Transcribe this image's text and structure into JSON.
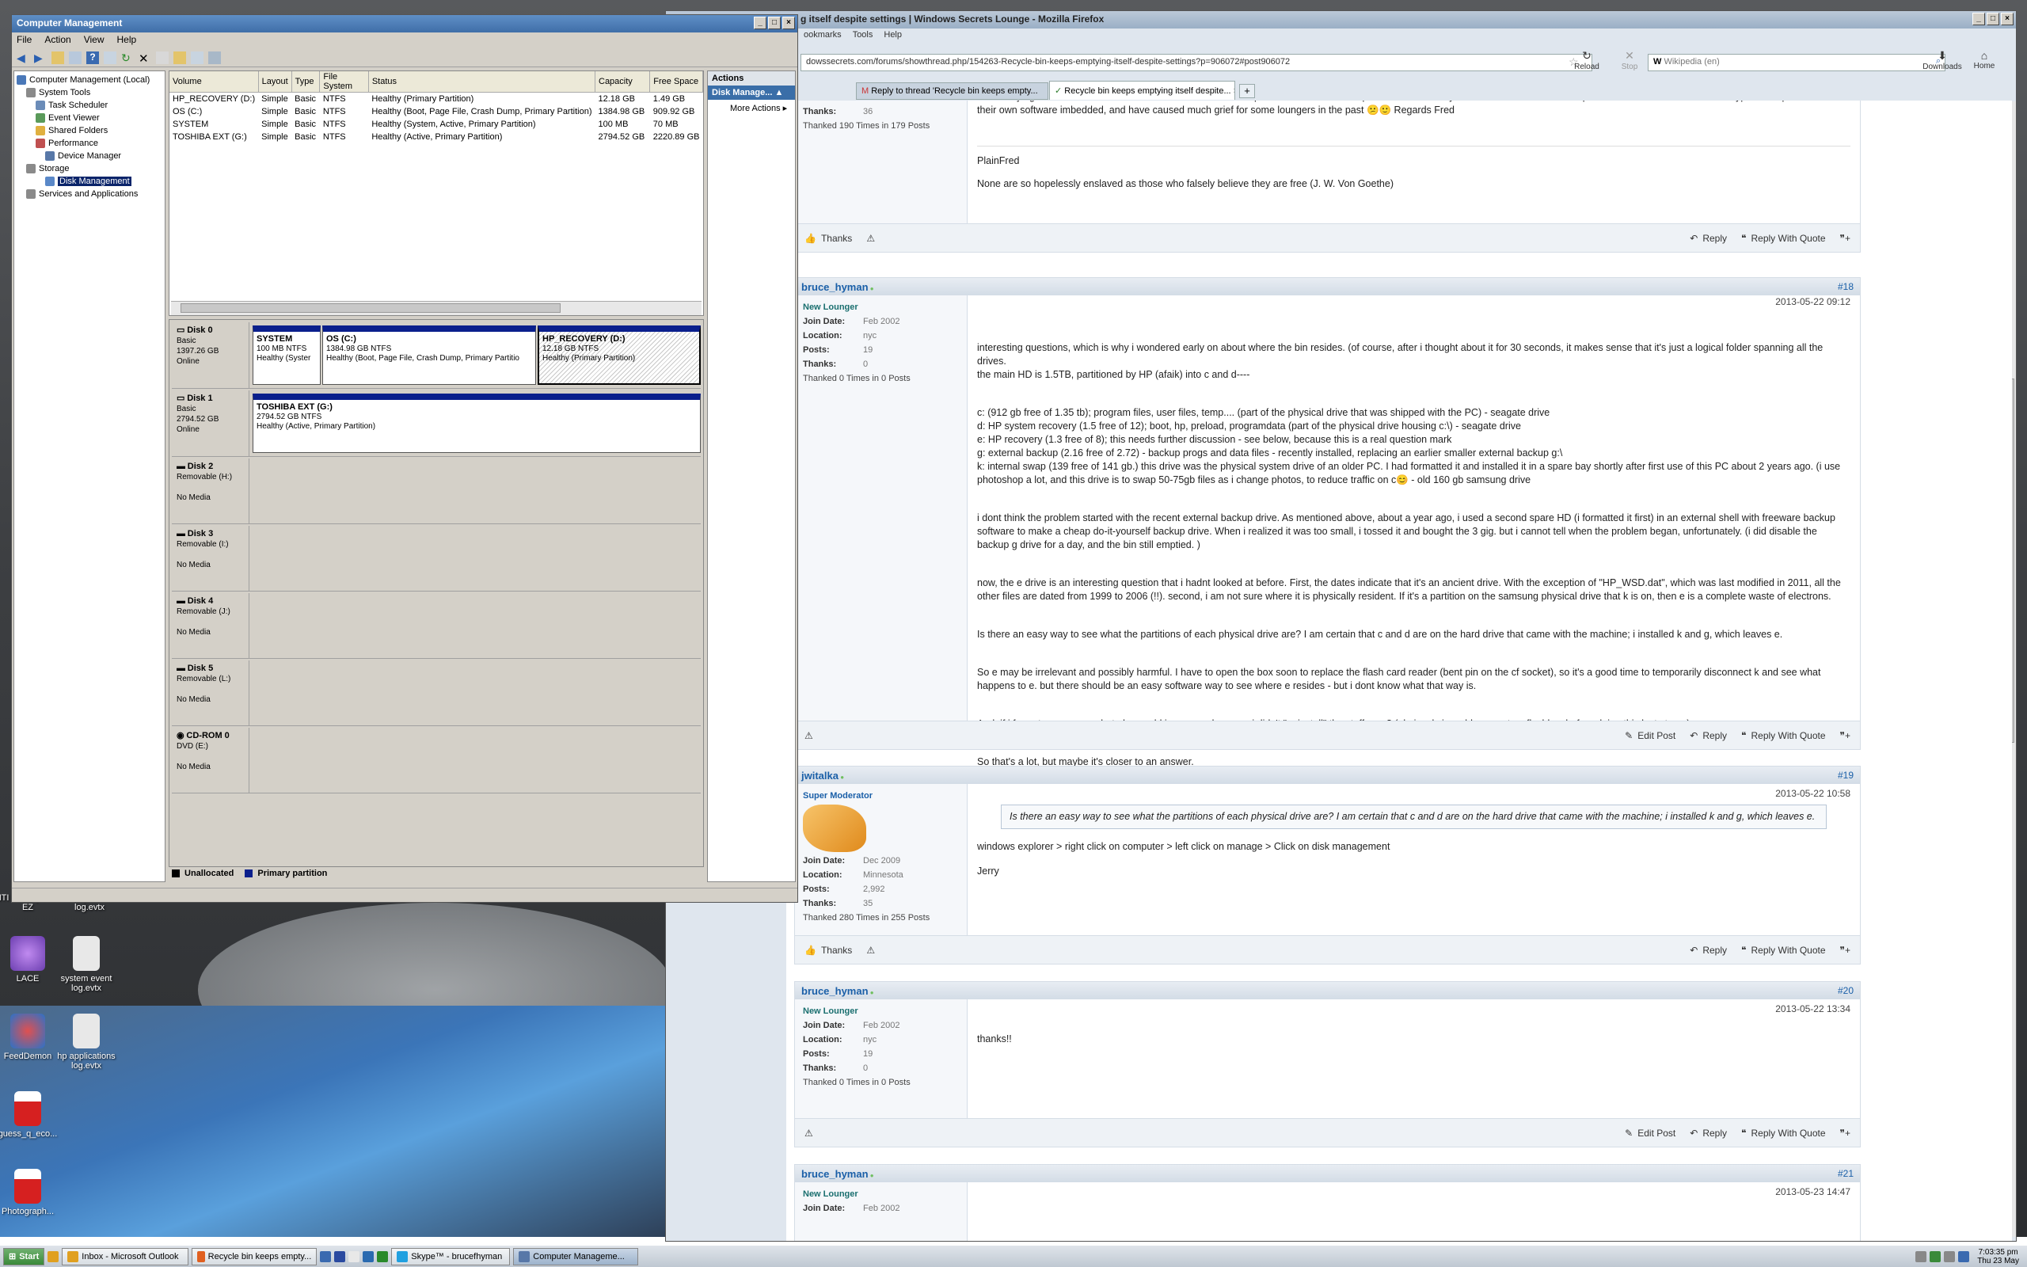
{
  "desktop": {
    "icons": [
      {
        "label": "NTI Backup Now EZ",
        "color": "#c43a2a"
      },
      {
        "label": "setup event log.evtx",
        "color": "#dcdcdc"
      },
      {
        "label": "LACE",
        "color": "#6c3fb0"
      },
      {
        "label": "system event log.evtx",
        "color": "#dcdcdc"
      },
      {
        "label": "FeedDemon",
        "color": "#2a72c9"
      },
      {
        "label": "hp applications log.evtx",
        "color": "#dcdcdc"
      },
      {
        "label": "guess_q_eco...",
        "color": "#d62020"
      },
      {
        "label": "Photograph...",
        "color": "#d62020"
      }
    ]
  },
  "cm": {
    "title": "Computer Management",
    "menu": [
      "File",
      "Action",
      "View",
      "Help"
    ],
    "tree": [
      {
        "label": "Computer Management (Local)",
        "indent": 0,
        "color": "#4a78b8"
      },
      {
        "label": "System Tools",
        "indent": 1,
        "color": "#8a8a8a"
      },
      {
        "label": "Task Scheduler",
        "indent": 2,
        "color": "#6b8cb8"
      },
      {
        "label": "Event Viewer",
        "indent": 2,
        "color": "#5a9a5a"
      },
      {
        "label": "Shared Folders",
        "indent": 2,
        "color": "#e0b040"
      },
      {
        "label": "Performance",
        "indent": 2,
        "color": "#c05050"
      },
      {
        "label": "Device Manager",
        "indent": 2,
        "color": "#5878a8"
      },
      {
        "label": "Storage",
        "indent": 1,
        "color": "#8a8a8a"
      },
      {
        "label": "Disk Management",
        "indent": 2,
        "color": "#5a88c8",
        "selected": true
      },
      {
        "label": "Services and Applications",
        "indent": 1,
        "color": "#8a8a8a"
      }
    ],
    "columns": [
      "Volume",
      "Layout",
      "Type",
      "File System",
      "Status",
      "Capacity",
      "Free Space"
    ],
    "volumes": [
      [
        "HP_RECOVERY (D:)",
        "Simple",
        "Basic",
        "NTFS",
        "Healthy (Primary Partition)",
        "12.18 GB",
        "1.49 GB"
      ],
      [
        "OS (C:)",
        "Simple",
        "Basic",
        "NTFS",
        "Healthy (Boot, Page File, Crash Dump, Primary Partition)",
        "1384.98 GB",
        "909.92 GB"
      ],
      [
        "SYSTEM",
        "Simple",
        "Basic",
        "NTFS",
        "Healthy (System, Active, Primary Partition)",
        "100 MB",
        "70 MB"
      ],
      [
        "TOSHIBA EXT (G:)",
        "Simple",
        "Basic",
        "NTFS",
        "Healthy (Active, Primary Partition)",
        "2794.52 GB",
        "2220.89 GB"
      ]
    ],
    "disks": [
      {
        "name": "Disk 0",
        "l1": "Basic",
        "l2": "1397.26 GB",
        "l3": "Online"
      },
      {
        "name": "Disk 1",
        "l1": "Basic",
        "l2": "2794.52 GB",
        "l3": "Online"
      },
      {
        "name": "Disk 2",
        "l1": "Removable (H:)",
        "l2": "",
        "l3": "No Media"
      },
      {
        "name": "Disk 3",
        "l1": "Removable (I:)",
        "l2": "",
        "l3": "No Media"
      },
      {
        "name": "Disk 4",
        "l1": "Removable (J:)",
        "l2": "",
        "l3": "No Media"
      },
      {
        "name": "Disk 5",
        "l1": "Removable (L:)",
        "l2": "",
        "l3": "No Media"
      },
      {
        "name": "CD-ROM 0",
        "l1": "DVD (E:)",
        "l2": "",
        "l3": "No Media"
      }
    ],
    "partitions": {
      "system": {
        "name": "SYSTEM",
        "size": "100 MB NTFS",
        "status": "Healthy (Syster"
      },
      "os": {
        "name": "OS  (C:)",
        "size": "1384.98 GB NTFS",
        "status": "Healthy (Boot, Page File, Crash Dump, Primary Partitio"
      },
      "recovery": {
        "name": "HP_RECOVERY  (D:)",
        "size": "12.18 GB NTFS",
        "status": "Healthy (Primary Partition)"
      },
      "toshiba": {
        "name": "TOSHIBA EXT  (G:)",
        "size": "2794.52 GB NTFS",
        "status": "Healthy (Active, Primary Partition)"
      }
    },
    "legend": {
      "unallocated": "Unallocated",
      "primary": "Primary partition"
    },
    "actions": {
      "header": "Actions",
      "sub": "Disk Manage...",
      "more": "More Actions"
    }
  },
  "ff": {
    "title": "g itself despite settings | Windows Secrets Lounge - Mozilla Firefox",
    "menu": [
      "ookmarks",
      "Tools",
      "Help"
    ],
    "url": "dowssecrets.com/forums/showthread.php/154263-Recycle-bin-keeps-emptying-itself-despite-settings?p=906072#post906072",
    "search_placeholder": "Wikipedia (en)",
    "reload": "Reload",
    "stop": "Stop",
    "downloads": "Downloads",
    "home": "Home",
    "tabs": [
      "Reply to thread 'Recycle bin keeps empty...",
      "Recycle bin keeps emptying itself despite..."
    ]
  },
  "posts": {
    "p17": {
      "thanks_v": "36",
      "thanked": "Thanked 190 Times in 179 Posts",
      "body_top": "Hello... trying to understand .. Don't know what an \"internal swap\" drive is ? Also did the problem start when you added the \"external backup drive\" ? ..... Some external USB type Backup Drives have their own software imbedded, and have caused much grief for some loungers in the past 😕🙂 Regards Fred",
      "sig1": "PlainFred",
      "sig2": "None are so hopelessly enslaved as those who falsely believe they are free (J. W. Von Goethe)"
    },
    "p18": {
      "user": "bruce_hyman",
      "num": "#18",
      "rank": "New Lounger",
      "date": "2013-05-22 09:12",
      "join": "Feb 2002",
      "location": "nyc",
      "posts": "19",
      "thanks": "0",
      "thanked": "Thanked 0 Times in 0 Posts",
      "paras": [
        "interesting questions, which is why i wondered early on about where the bin resides. (of course, after i thought about it for 30 seconds, it makes sense that it's just a logical folder spanning all the drives.\nthe main HD is 1.5TB, partitioned by HP (afaik) into c and d----",
        "c: (912 gb free of 1.35 tb); program files, user files, temp.... (part of the physical drive that was shipped with the PC) - seagate drive\nd: HP system recovery (1.5 free of 12); boot, hp, preload, programdata (part of the physical drive housing c:\\) - seagate drive\ne: HP recovery (1.3 free of 8); this needs further discussion - see below, because this is a real question mark\ng: external backup (2.16 free of 2.72) - backup progs and data files - recently installed, replacing an earlier smaller external backup g:\\\nk: internal swap (139 free of 141 gb.) this drive was the physical system drive of an older PC. I had formatted it and installed it in a spare bay shortly after first use of this PC about 2 years ago. (i use photoshop a lot, and this drive is to swap 50-75gb files as i change photos, to reduce traffic on c😊 - old 160 gb samsung drive",
        "i dont think the problem started with the recent external backup drive. As mentioned above, about a year ago, i used a second spare HD (i formatted it first) in an external shell with freeware backup software to make a cheap do-it-yourself backup drive. When i realized it was too small, i tossed it and bought the 3 gig. but i cannot tell when the problem began, unfortunately. (i did disable the backup g drive for a day, and the bin still emptied. )",
        "now, the e drive is an interesting question that i hadnt looked at before. First, the dates indicate that it's an ancient drive. With the exception of \"HP_WSD.dat\", which was last modified in 2011, all the other files are dated from 1999 to 2006 (!!). second, i am not sure where it is physically resident. If it's a partition on the samsung physical drive that k is on, then e is a complete waste of electrons.",
        "Is there an easy way to see what the partitions of each physical drive are? I am certain that c and d are on the hard drive that came with the machine; i installed k and g, which leaves e.",
        "So e may be irrelevant and possibly harmful. I have to open the box soon to replace the flash card reader (bent pin on the cf socket), so it's a good time to temporarily disconnect k and see what happens to e. but there should be an easy software way to see where e resides - but i dont know what that way is.",
        "And, if i format or erase e, what else could i screw up because i didn't \"uninstall\" the stuff on e? (obviously i would copy e to a flashkey before doing this last step...)",
        "So that's a lot, but maybe it's closer to an answer."
      ]
    },
    "p19": {
      "user": "jwitalka",
      "num": "#19",
      "rank": "Super Moderator",
      "date": "2013-05-22 10:58",
      "join": "Dec 2009",
      "location": "Minnesota",
      "posts": "2,992",
      "thanks": "35",
      "thanked": "Thanked 280 Times in 255 Posts",
      "quote": "Is there an easy way to see what the partitions of each physical drive are? I am certain that c and d are on the hard drive that came with the machine; i installed k and g, which leaves e.",
      "line1": "windows explorer > right click on computer > left click on manage > Click on disk management",
      "line2": "Jerry"
    },
    "p20": {
      "user": "bruce_hyman",
      "num": "#20",
      "rank": "New Lounger",
      "date": "2013-05-22 13:34",
      "join": "Feb 2002",
      "location": "nyc",
      "posts": "19",
      "thanks": "0",
      "thanked": "Thanked 0 Times in 0 Posts",
      "body": "thanks!!"
    },
    "p21": {
      "user": "bruce_hyman",
      "num": "#21",
      "rank": "New Lounger",
      "date": "2013-05-23 14:47",
      "join": "Feb 2002"
    },
    "labels": {
      "join": "Join Date:",
      "location": "Location:",
      "posts": "Posts:",
      "thanks": "Thanks:",
      "thanks_btn": "Thanks",
      "reply": "Reply",
      "reply_quote": "Reply With Quote",
      "edit": "Edit Post"
    }
  },
  "taskbar": {
    "start": "Start",
    "items": [
      {
        "label": "Inbox - Microsoft Outlook",
        "color": "#e0a020"
      },
      {
        "label": "Recycle bin keeps empty...",
        "color": "#e06020"
      },
      {
        "label": "Skype™ - brucefhyman",
        "color": "#20a0e0"
      },
      {
        "label": "Computer Manageme...",
        "color": "#5878a8",
        "active": true
      }
    ],
    "time": "7:03:35 pm",
    "date": "Thu 23 May"
  }
}
